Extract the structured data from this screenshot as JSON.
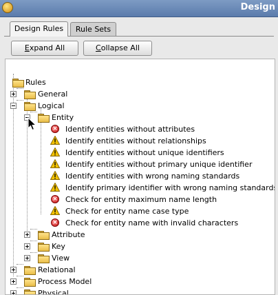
{
  "window": {
    "title": "Design"
  },
  "tabs": [
    {
      "label": "Design Rules",
      "active": true
    },
    {
      "label": "Rule Sets",
      "active": false
    }
  ],
  "buttons": {
    "expand_all": {
      "mnemonic": "E",
      "rest": "xpand All"
    },
    "collapse_all": {
      "mnemonic": "C",
      "rest": "ollapse All"
    }
  },
  "tree": {
    "root": "Rules",
    "general": "General",
    "logical": "Logical",
    "entity": "Entity",
    "entity_rules": [
      {
        "label": "Identify entities without attributes",
        "severity": "error"
      },
      {
        "label": "Identify entities without relationships",
        "severity": "warning"
      },
      {
        "label": "Identify entities without unique identifiers",
        "severity": "warning"
      },
      {
        "label": "Identify entities without primary unique identifier",
        "severity": "warning"
      },
      {
        "label": "Identify entities with wrong naming standards",
        "severity": "warning"
      },
      {
        "label": "Identify primary identifier with wrong naming standards",
        "severity": "warning"
      },
      {
        "label": "Check for entity maximum name length",
        "severity": "error"
      },
      {
        "label": "Check for entity name case type",
        "severity": "warning"
      },
      {
        "label": "Check for entity name with invalid characters",
        "severity": "error"
      }
    ],
    "attribute": "Attribute",
    "key": "Key",
    "view": "View",
    "relational": "Relational",
    "process_model": "Process Model",
    "physical": "Physical"
  },
  "colors": {
    "titlebar": "#5b7bac",
    "error": "#c41010",
    "warning": "#f2c200",
    "folder": "#e9be49"
  }
}
